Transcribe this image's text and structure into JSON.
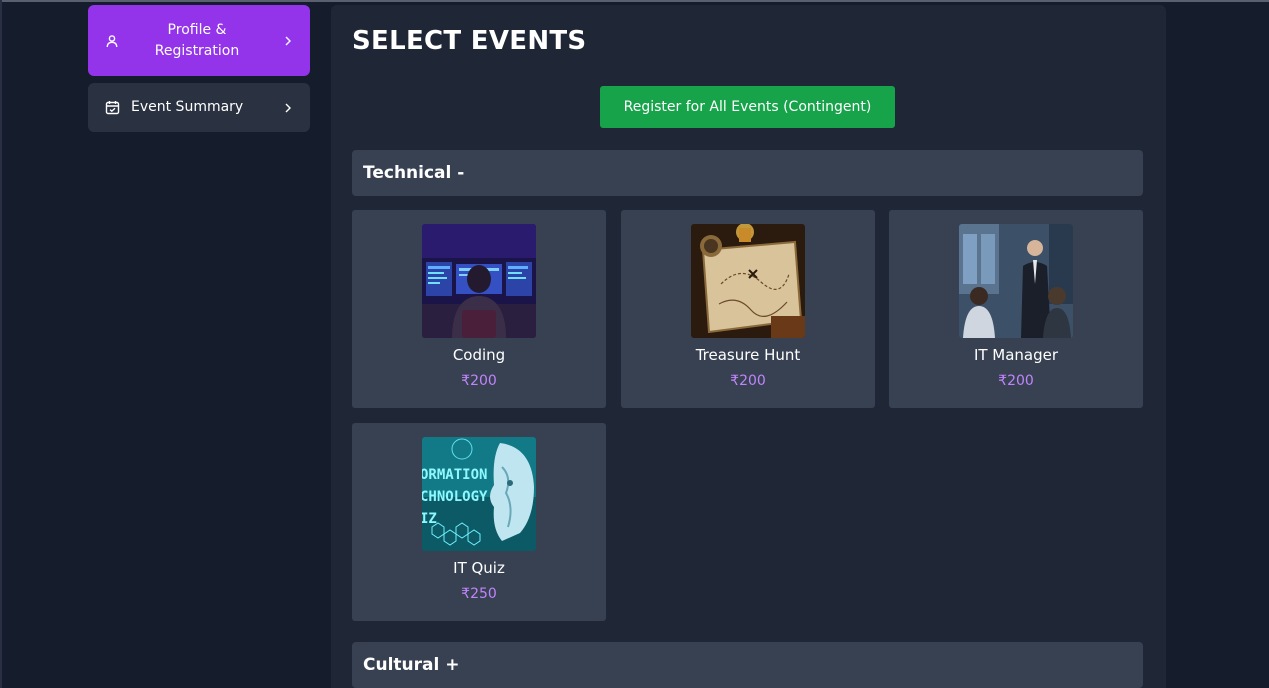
{
  "sidebar": {
    "items": [
      {
        "label": "Profile & Registration",
        "icon": "user-icon",
        "active": true
      },
      {
        "label": "Event Summary",
        "icon": "calendar-check-icon",
        "active": false
      }
    ]
  },
  "main": {
    "title": "SELECT EVENTS",
    "register_all_label": "Register for All Events (Contingent)",
    "sections": [
      {
        "label": "Technical -",
        "expanded": true,
        "events": [
          {
            "name": "Coding",
            "price": "₹200",
            "image": "coding-image"
          },
          {
            "name": "Treasure Hunt",
            "price": "₹200",
            "image": "treasure-map-image"
          },
          {
            "name": "IT Manager",
            "price": "₹200",
            "image": "business-meeting-image"
          },
          {
            "name": "IT Quiz",
            "price": "₹250",
            "image": "ai-head-image",
            "image_text": [
              "ORMATION",
              "CHNOLOGY",
              "IZ"
            ]
          }
        ]
      },
      {
        "label": "Cultural +",
        "expanded": false
      }
    ]
  },
  "colors": {
    "background": "#151c2c",
    "panel": "#1f2737",
    "card": "#374151",
    "accent": "#9333ea",
    "success": "#16a34a",
    "price": "#c084fc"
  }
}
